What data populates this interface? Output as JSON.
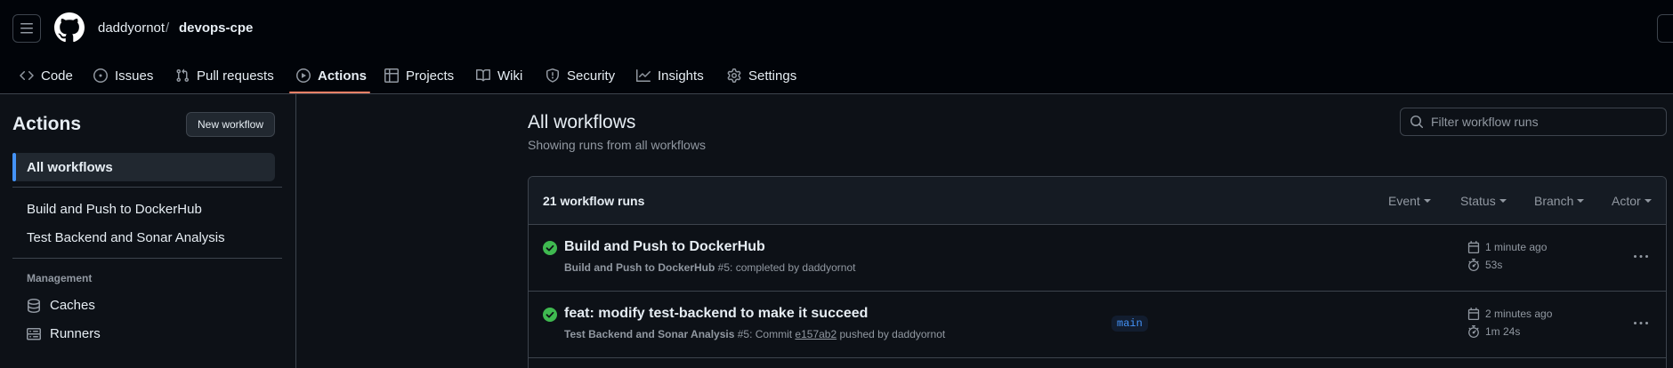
{
  "header": {
    "owner": "daddyornot",
    "separator": "/",
    "repo": "devops-cpe"
  },
  "nav": {
    "code": "Code",
    "issues": "Issues",
    "pull_requests": "Pull requests",
    "actions": "Actions",
    "projects": "Projects",
    "wiki": "Wiki",
    "security": "Security",
    "insights": "Insights",
    "settings": "Settings"
  },
  "sidebar": {
    "title": "Actions",
    "new_workflow": "New workflow",
    "all_workflows": "All workflows",
    "workflows": [
      "Build and Push to DockerHub",
      "Test Backend and Sonar Analysis"
    ],
    "management_label": "Management",
    "caches": "Caches",
    "runners": "Runners"
  },
  "main": {
    "title": "All workflows",
    "subtitle": "Showing runs from all workflows",
    "filter_placeholder": "Filter workflow runs",
    "runs_count": "21 workflow runs",
    "filters": {
      "event": "Event",
      "status": "Status",
      "branch": "Branch",
      "actor": "Actor"
    },
    "runs": [
      {
        "title": "Build and Push to DockerHub",
        "workflow": "Build and Push to DockerHub",
        "meta": " #5: completed by daddyornot",
        "time": "1 minute ago",
        "duration": "53s",
        "status": "success"
      },
      {
        "title": "feat: modify test-backend to make it succeed",
        "workflow": "Test Backend and Sonar Analysis",
        "meta_prefix": " #5: Commit ",
        "sha": "e157ab2",
        "meta_suffix": " pushed by daddyornot",
        "branch": "main",
        "time": "2 minutes ago",
        "duration": "1m 24s",
        "status": "success"
      }
    ]
  },
  "colors": {
    "accent": "#4493f8",
    "nav_underline": "#f78166",
    "success": "#3fb950",
    "background": "#0d1117",
    "header_bg": "#010409"
  }
}
